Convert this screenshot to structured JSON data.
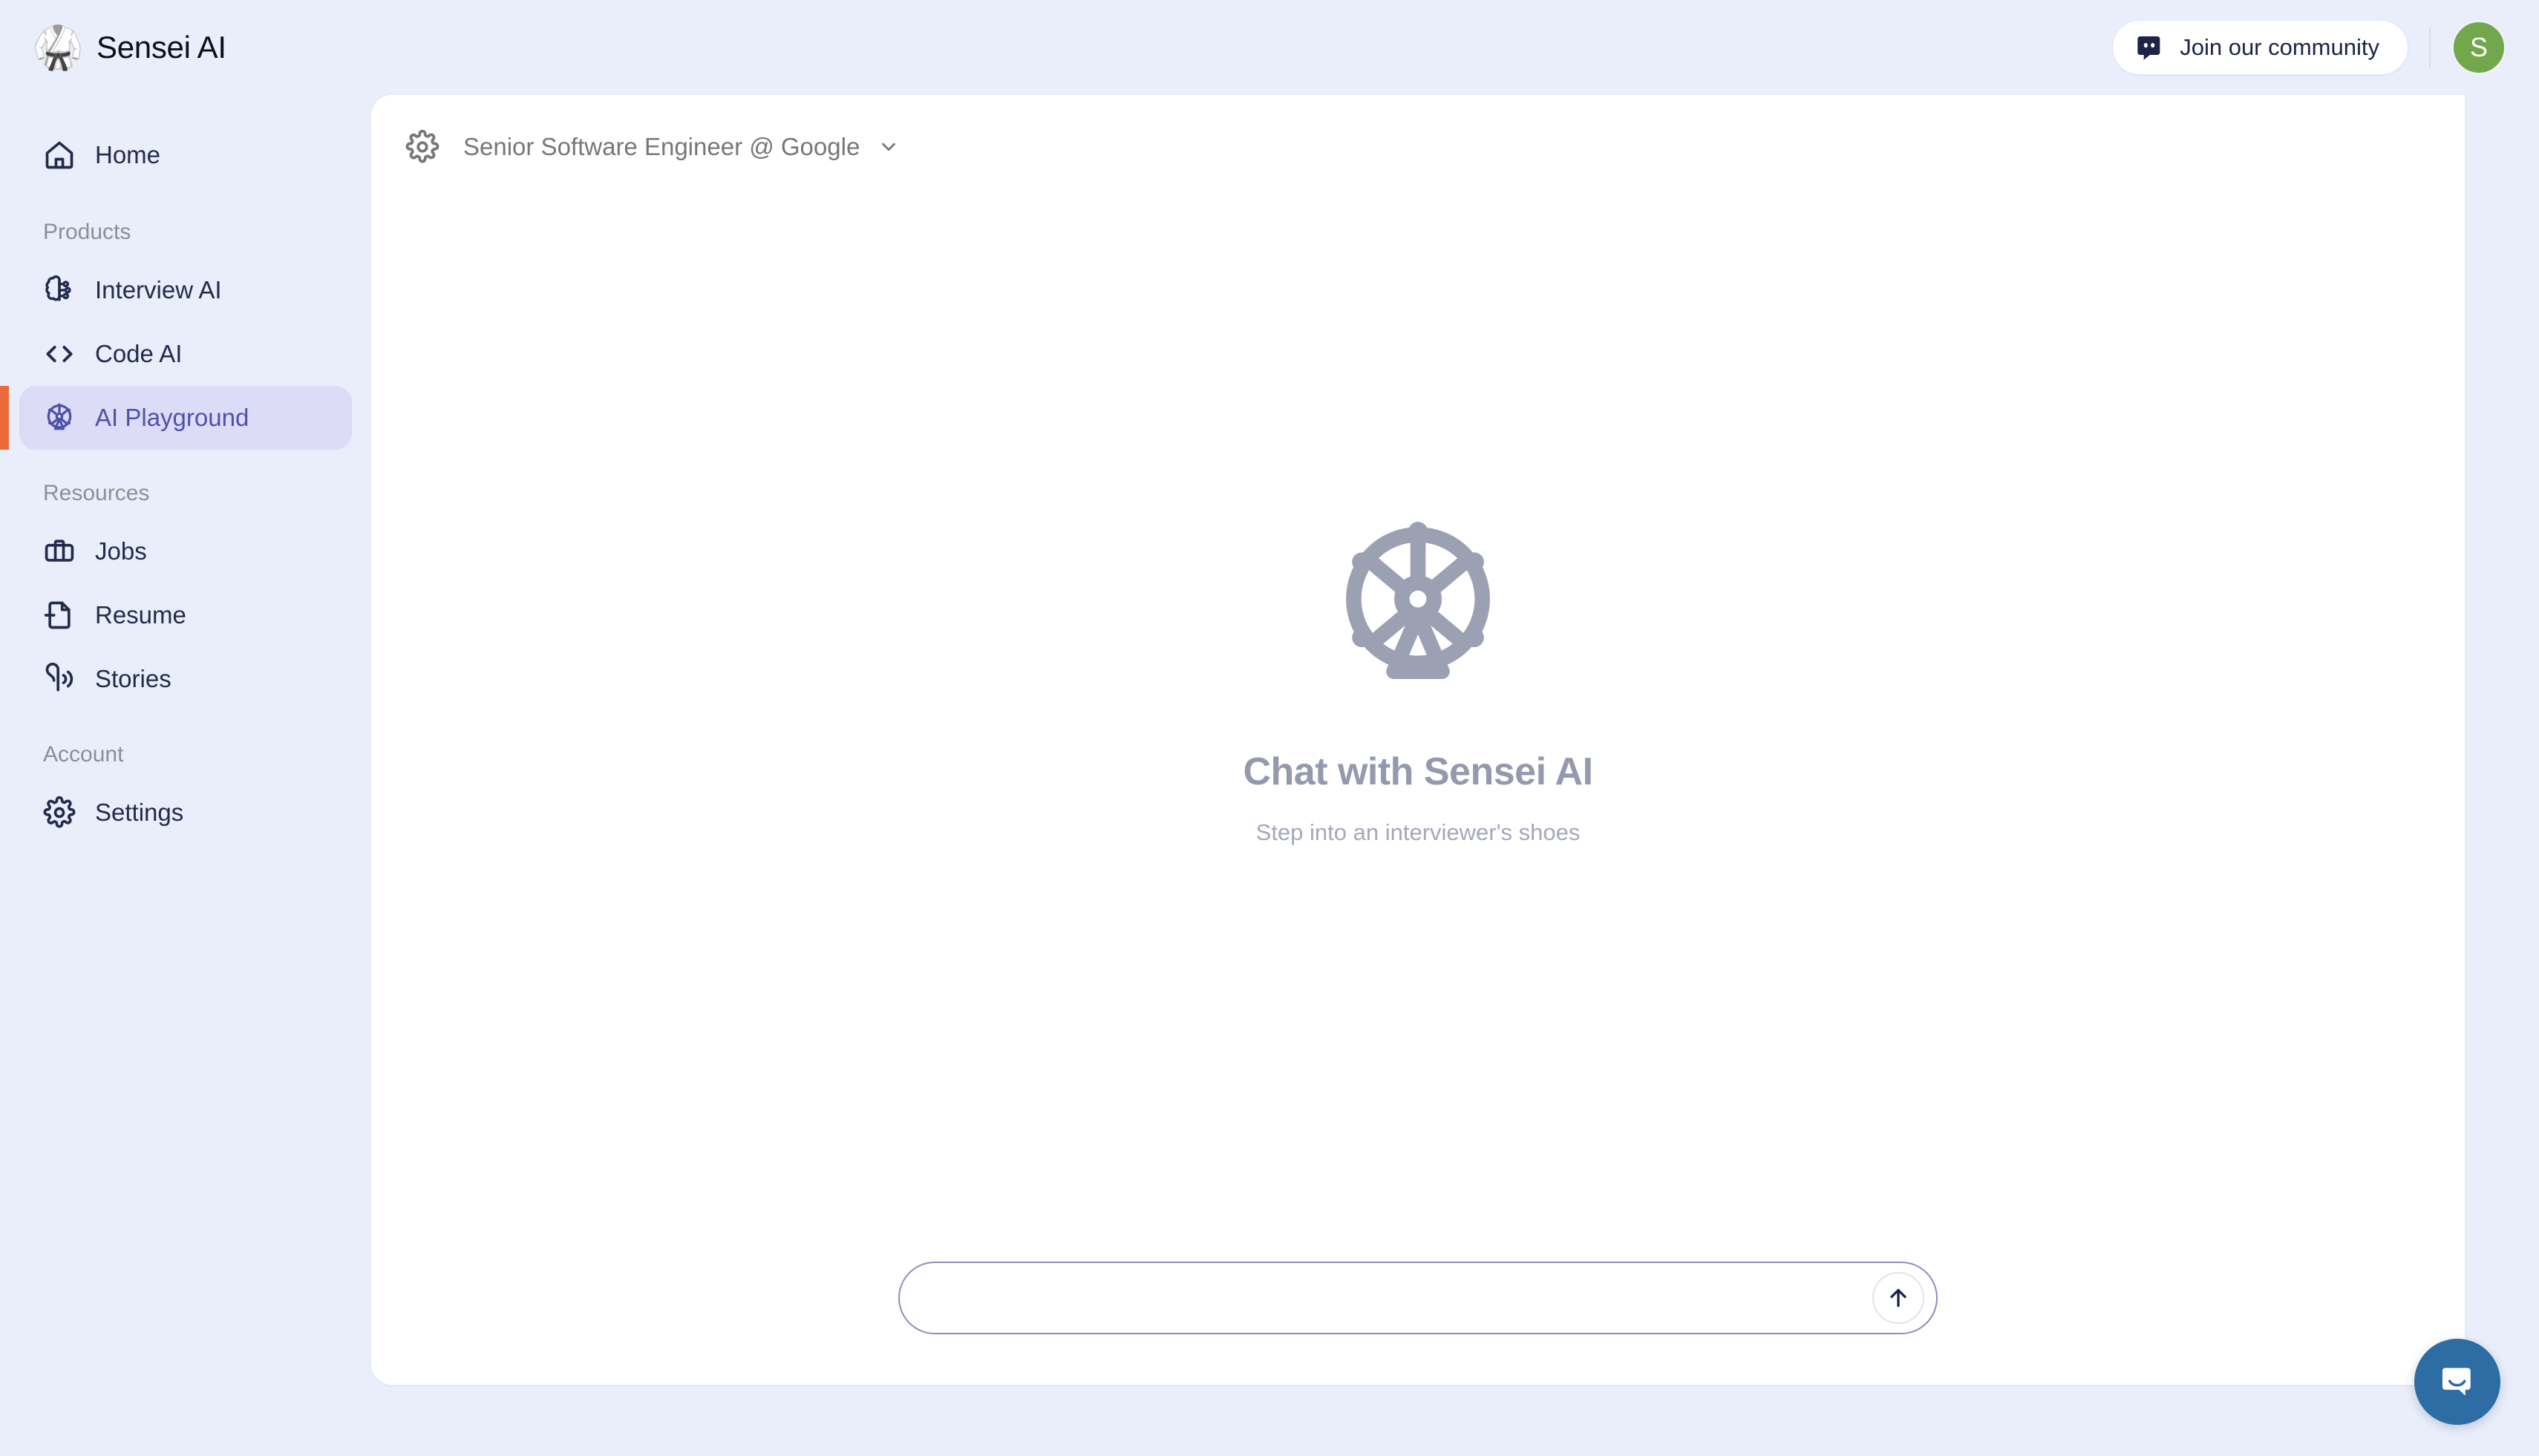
{
  "app": {
    "logo_emoji": "🥋",
    "name": "Sensei AI"
  },
  "topbar": {
    "community_label": "Join our community",
    "community_icon": "discord-icon",
    "avatar_initial": "S",
    "avatar_color": "#72a84b"
  },
  "sidebar": {
    "items": [
      {
        "label": "Home",
        "icon": "home-icon",
        "active": false
      },
      {
        "label": "Interview AI",
        "icon": "brain-circuit-icon",
        "active": false
      },
      {
        "label": "Code AI",
        "icon": "code-brackets-icon",
        "active": false
      },
      {
        "label": "AI Playground",
        "icon": "ferris-wheel-icon",
        "active": true
      },
      {
        "label": "Jobs",
        "icon": "briefcase-icon",
        "active": false
      },
      {
        "label": "Resume",
        "icon": "file-plus-icon",
        "active": false
      },
      {
        "label": "Stories",
        "icon": "ear-listen-icon",
        "active": false
      },
      {
        "label": "Settings",
        "icon": "gear-icon",
        "active": false
      }
    ],
    "sections": {
      "products": "Products",
      "resources": "Resources",
      "account": "Account"
    },
    "active_accent_color": "#ea6a3c",
    "active_bg_color": "#dcdcf7",
    "active_text_color": "#4f51ab"
  },
  "main": {
    "header": {
      "settings_icon": "gear-icon",
      "role": "Senior Software Engineer @ Google",
      "chevron": "chevron-down-icon"
    },
    "empty_state": {
      "icon": "ferris-wheel-icon",
      "title": "Chat with Sensei AI",
      "subtitle": "Step into an interviewer's shoes"
    },
    "composer": {
      "value": "",
      "placeholder": "",
      "send_icon": "arrow-up-icon"
    }
  },
  "widget": {
    "launcher_icon": "chat-bubble-icon",
    "color": "#2e6ca4"
  }
}
